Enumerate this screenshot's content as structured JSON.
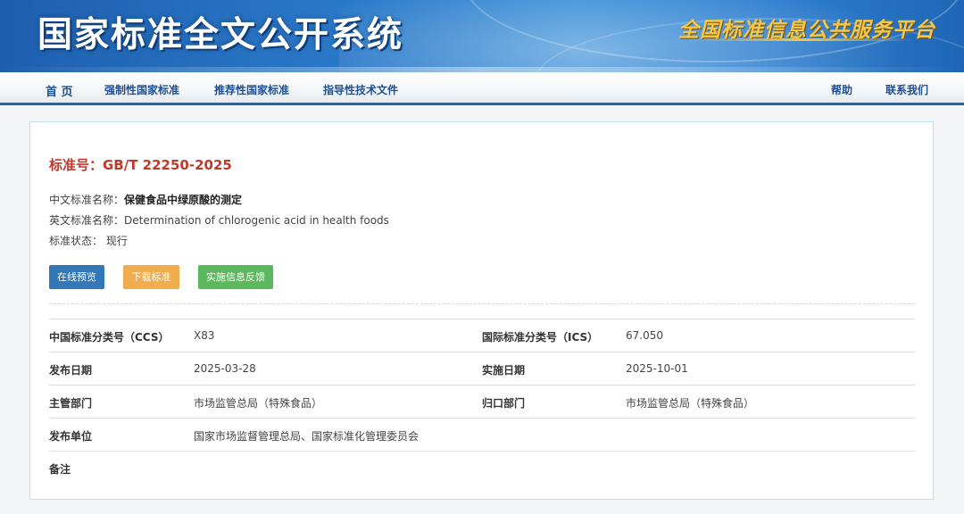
{
  "header": {
    "site_title": "国家标准全文公开系统",
    "slogan": "全国标准信息公共服务平台"
  },
  "nav": {
    "left": [
      "首 页",
      "强制性国家标准",
      "推荐性国家标准",
      "指导性技术文件"
    ],
    "right": [
      "帮助",
      "联系我们"
    ]
  },
  "standard": {
    "number": "标准号：GB/T 22250-2025",
    "cn_name_label": "中文标准名称：",
    "cn_name": "保健食品中绿原酸的测定",
    "en_name_label": "英文标准名称：",
    "en_name": "Determination of chlorogenic acid in health foods",
    "status_label": "标准状态：",
    "status": "现行"
  },
  "buttons": {
    "preview": "在线预览",
    "download": "下载标准",
    "feedback": "实施信息反馈"
  },
  "details": {
    "ccs_label": "中国标准分类号（CCS）",
    "ccs_value": "X83",
    "ics_label": "国际标准分类号（ICS）",
    "ics_value": "67.050",
    "publish_date_label": "发布日期",
    "publish_date": "2025-03-28",
    "impl_date_label": "实施日期",
    "impl_date": "2025-10-01",
    "dept_label": "主管部门",
    "dept": "市场监管总局（特殊食品）",
    "owner_label": "归口部门",
    "owner": "市场监管总局（特殊食品）",
    "publisher_label": "发布单位",
    "publisher": "国家市场监督管理总局、国家标准化管理委员会",
    "remark_label": "备注",
    "remark": ""
  },
  "colors": {
    "brand_blue": "#1f63b3",
    "std_number_red": "#c0392b",
    "btn_preview": "#3377b6",
    "btn_download": "#f0ad4e",
    "btn_feedback": "#5cb85c"
  }
}
